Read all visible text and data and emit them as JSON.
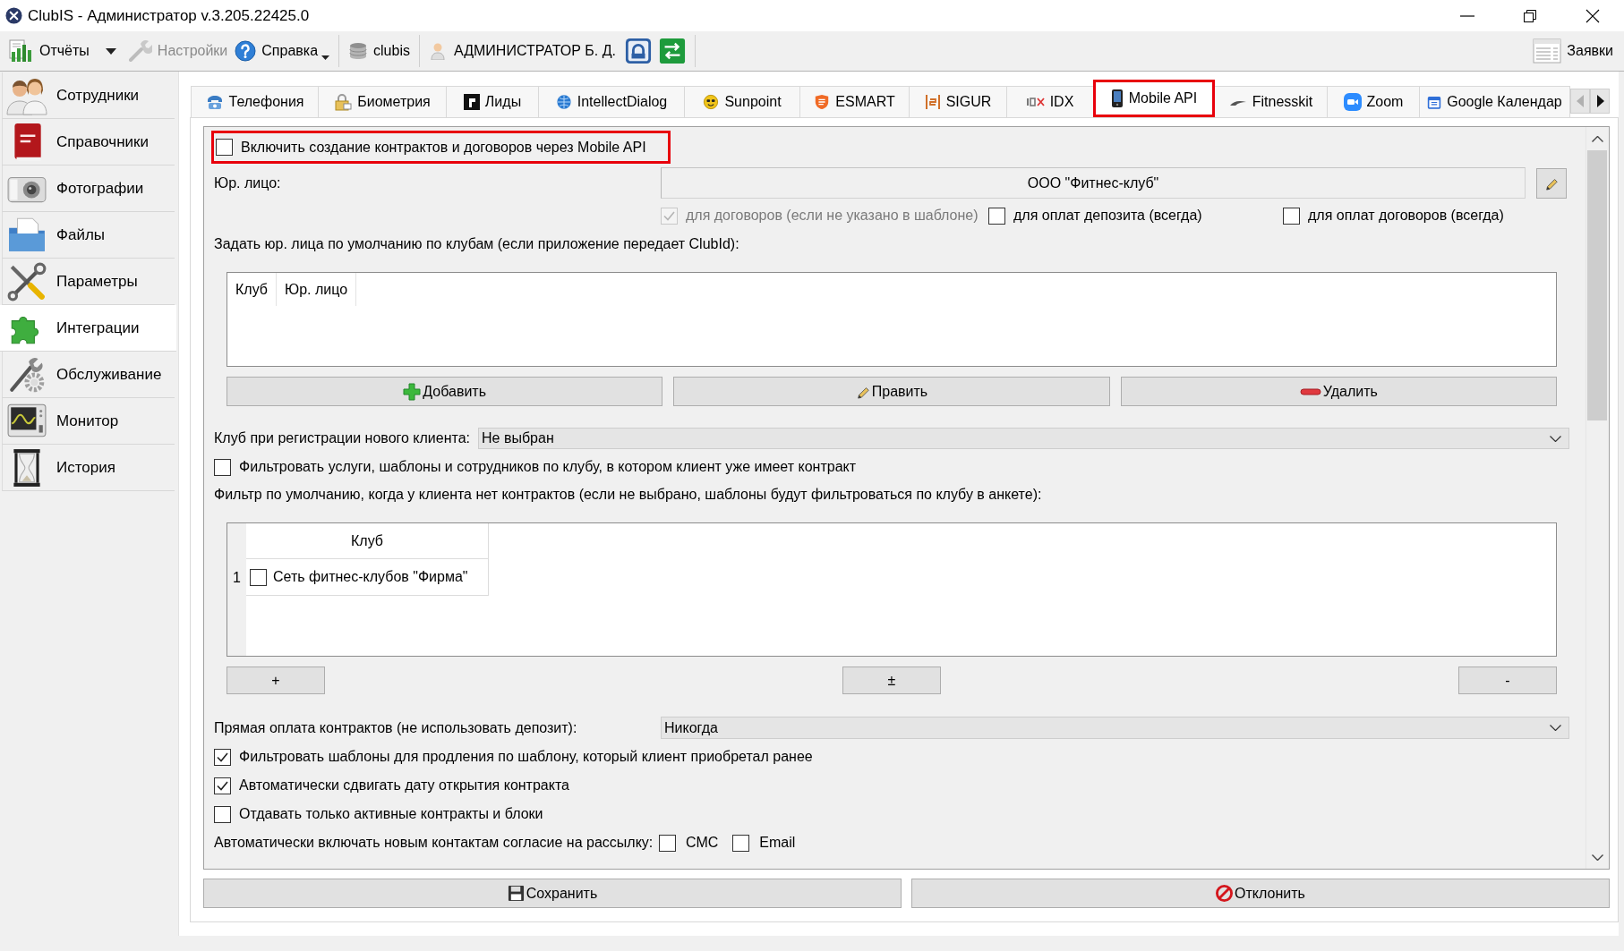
{
  "window": {
    "title": "ClubIS - Администратор v.3.205.22425.0"
  },
  "toolbar": {
    "groups": [
      [
        {
          "kind": "split",
          "label": "Отчёты",
          "disabled": false
        },
        {
          "kind": "plain",
          "label": "Настройки",
          "disabled": true
        },
        {
          "kind": "menu",
          "label": "Справка",
          "disabled": false
        }
      ],
      [
        {
          "kind": "plain",
          "label": "clubis",
          "disabled": false
        }
      ],
      [
        {
          "kind": "user",
          "label": "АДМИНИСТРАТОР Б. Д.",
          "disabled": false
        },
        {
          "kind": "icon",
          "disabled": false
        },
        {
          "kind": "icon",
          "disabled": false
        }
      ]
    ],
    "right": [
      {
        "kind": "plain",
        "label": "Заявки",
        "disabled": false
      }
    ]
  },
  "sidebar": {
    "items": [
      {
        "label": "Сотрудники",
        "selected": false
      },
      {
        "label": "Справочники",
        "selected": false
      },
      {
        "label": "Фотографии",
        "selected": false
      },
      {
        "label": "Файлы",
        "selected": false
      },
      {
        "label": "Параметры",
        "selected": false
      },
      {
        "label": "Интеграции",
        "selected": true
      },
      {
        "label": "Обслуживание",
        "selected": false
      },
      {
        "label": "Монитор",
        "selected": false
      },
      {
        "label": "История",
        "selected": false
      }
    ]
  },
  "tabs": {
    "items": [
      {
        "label": "Телефония",
        "selected": false,
        "highlighted": false
      },
      {
        "label": "Биометрия",
        "selected": false,
        "highlighted": false
      },
      {
        "label": "Лиды",
        "selected": false,
        "highlighted": false
      },
      {
        "label": "IntellectDialog",
        "selected": false,
        "highlighted": false
      },
      {
        "label": "Sunpoint",
        "selected": false,
        "highlighted": false
      },
      {
        "label": "ESMART",
        "selected": false,
        "highlighted": false
      },
      {
        "label": "SIGUR",
        "selected": false,
        "highlighted": false
      },
      {
        "label": "IDX",
        "selected": false,
        "highlighted": false
      },
      {
        "label": "Mobile API",
        "selected": true,
        "highlighted": true
      },
      {
        "label": "Fitnesskit",
        "selected": false,
        "highlighted": false
      },
      {
        "label": "Zoom",
        "selected": false,
        "highlighted": false
      },
      {
        "label": "Google Календар",
        "selected": false,
        "highlighted": false
      }
    ],
    "scroll": {
      "left_disabled": true,
      "right_disabled": false
    }
  },
  "mobile_api": {
    "enable_option": {
      "label": "Включить создание контрактов и договоров через Mobile API",
      "checked": false,
      "highlighted": true
    },
    "legal_entity": {
      "label": "Юр. лицо:",
      "value": "ООО \"Фитнес-клуб\""
    },
    "legal_entity_scopes": [
      {
        "label": "для договоров (если не указано в шаблоне)",
        "checked": true,
        "disabled": true
      },
      {
        "label": "для оплат депозита (всегда)",
        "checked": false,
        "disabled": false
      },
      {
        "label": "для оплат договоров (всегда)",
        "checked": false,
        "disabled": false
      }
    ],
    "club_entities": {
      "label": "Задать юр. лица по умолчанию по клубам (если приложение передает ClubId):",
      "columns": [
        "Клуб",
        "Юр. лицо"
      ],
      "buttons": [
        "Добавить",
        "Править",
        "Удалить"
      ]
    },
    "registration_club": {
      "label": "Клуб при регистрации нового клиента:",
      "value": "Не выбран"
    },
    "filter_by_contract_club": {
      "label": "Фильтровать услуги, шаблоны и сотрудников по клубу, в котором клиент уже имеет контракт",
      "checked": false
    },
    "default_filter": {
      "label": "Фильтр по умолчанию, когда у клиента нет контрактов (если не выбрано, шаблоны будут фильтроваться по клубу в анкете):",
      "columns": [
        "Клуб"
      ],
      "rows": [
        {
          "number": "1",
          "club": "Сеть фитнес-клубов \"Фирма\"",
          "checked": false
        }
      ],
      "buttons": [
        "+",
        "±",
        "-"
      ]
    },
    "direct_payment": {
      "label": "Прямая оплата контрактов (не использовать депозит):",
      "value": "Никогда"
    },
    "options": [
      {
        "label": "Фильтровать шаблоны для продления по шаблону, который клиент приобретал ранее",
        "checked": true
      },
      {
        "label": "Автоматически сдвигать дату открытия контракта",
        "checked": true
      },
      {
        "label": "Отдавать только активные контракты и блоки",
        "checked": false
      }
    ],
    "mailing_consent": {
      "label": "Автоматически включать новым контактам согласие на рассылку:",
      "channels": [
        {
          "label": "СМС",
          "checked": false
        },
        {
          "label": "Email",
          "checked": false
        }
      ]
    },
    "actions": [
      "Сохранить",
      "Отклонить"
    ]
  }
}
